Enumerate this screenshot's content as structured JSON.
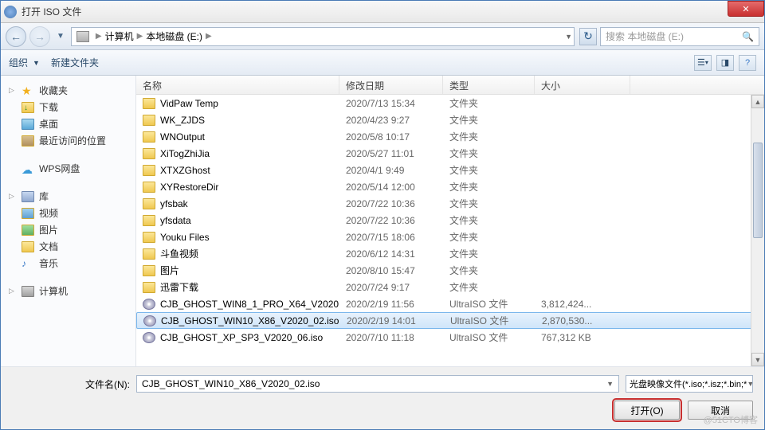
{
  "title": "打开 ISO 文件",
  "breadcrumb": {
    "root": "计算机",
    "drive": "本地磁盘 (E:)"
  },
  "search_placeholder": "搜索 本地磁盘 (E:)",
  "toolbar": {
    "organize": "组织",
    "newfolder": "新建文件夹"
  },
  "columns": {
    "name": "名称",
    "date": "修改日期",
    "type": "类型",
    "size": "大小"
  },
  "sidebar": {
    "favorites": "收藏夹",
    "downloads": "下载",
    "desktop": "桌面",
    "recent": "最近访问的位置",
    "wps": "WPS网盘",
    "libraries": "库",
    "videos": "视频",
    "pictures": "图片",
    "documents": "文档",
    "music": "音乐",
    "computer": "计算机"
  },
  "files": [
    {
      "name": "VidPaw Temp",
      "date": "2020/7/13 15:34",
      "type": "文件夹",
      "size": "",
      "kind": "folder"
    },
    {
      "name": "WK_ZJDS",
      "date": "2020/4/23 9:27",
      "type": "文件夹",
      "size": "",
      "kind": "folder"
    },
    {
      "name": "WNOutput",
      "date": "2020/5/8 10:17",
      "type": "文件夹",
      "size": "",
      "kind": "folder"
    },
    {
      "name": "XiTogZhiJia",
      "date": "2020/5/27 11:01",
      "type": "文件夹",
      "size": "",
      "kind": "folder"
    },
    {
      "name": "XTXZGhost",
      "date": "2020/4/1 9:49",
      "type": "文件夹",
      "size": "",
      "kind": "folder"
    },
    {
      "name": "XYRestoreDir",
      "date": "2020/5/14 12:00",
      "type": "文件夹",
      "size": "",
      "kind": "folder"
    },
    {
      "name": "yfsbak",
      "date": "2020/7/22 10:36",
      "type": "文件夹",
      "size": "",
      "kind": "folder"
    },
    {
      "name": "yfsdata",
      "date": "2020/7/22 10:36",
      "type": "文件夹",
      "size": "",
      "kind": "folder"
    },
    {
      "name": "Youku Files",
      "date": "2020/7/15 18:06",
      "type": "文件夹",
      "size": "",
      "kind": "folder"
    },
    {
      "name": "斗鱼视频",
      "date": "2020/6/12 14:31",
      "type": "文件夹",
      "size": "",
      "kind": "folder"
    },
    {
      "name": "图片",
      "date": "2020/8/10 15:47",
      "type": "文件夹",
      "size": "",
      "kind": "folder"
    },
    {
      "name": "迅雷下载",
      "date": "2020/7/24 9:17",
      "type": "文件夹",
      "size": "",
      "kind": "folder"
    },
    {
      "name": "CJB_GHOST_WIN8_1_PRO_X64_V2020...",
      "date": "2020/2/19 11:56",
      "type": "UltraISO 文件",
      "size": "3,812,424...",
      "kind": "iso"
    },
    {
      "name": "CJB_GHOST_WIN10_X86_V2020_02.iso",
      "date": "2020/2/19 14:01",
      "type": "UltraISO 文件",
      "size": "2,870,530...",
      "kind": "iso",
      "selected": true
    },
    {
      "name": "CJB_GHOST_XP_SP3_V2020_06.iso",
      "date": "2020/7/10 11:18",
      "type": "UltraISO 文件",
      "size": "767,312 KB",
      "kind": "iso"
    }
  ],
  "filename_label": "文件名(N):",
  "filename_value": "CJB_GHOST_WIN10_X86_V2020_02.iso",
  "filter_value": "光盘映像文件(*.iso;*.isz;*.bin;*",
  "open_btn": "打开(O)",
  "cancel_btn": "取消",
  "watermark": "@51CTO博客"
}
